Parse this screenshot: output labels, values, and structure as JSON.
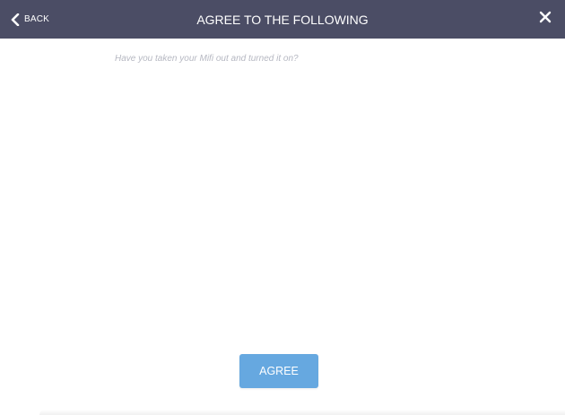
{
  "header": {
    "back_label": "BACK",
    "title": "AGREE TO THE FOLLOWING",
    "back_icon": "chevron-left-icon",
    "close_icon": "close-icon"
  },
  "content": {
    "question": "Have you taken your Mifi out and turned it on?"
  },
  "actions": {
    "agree_label": "AGREE"
  },
  "colors": {
    "header_background": "#4b4d65",
    "header_text": "#ffffff",
    "question_text": "#b6b8c2",
    "agree_button": "#66a8e0",
    "page_background": "#ffffff"
  }
}
